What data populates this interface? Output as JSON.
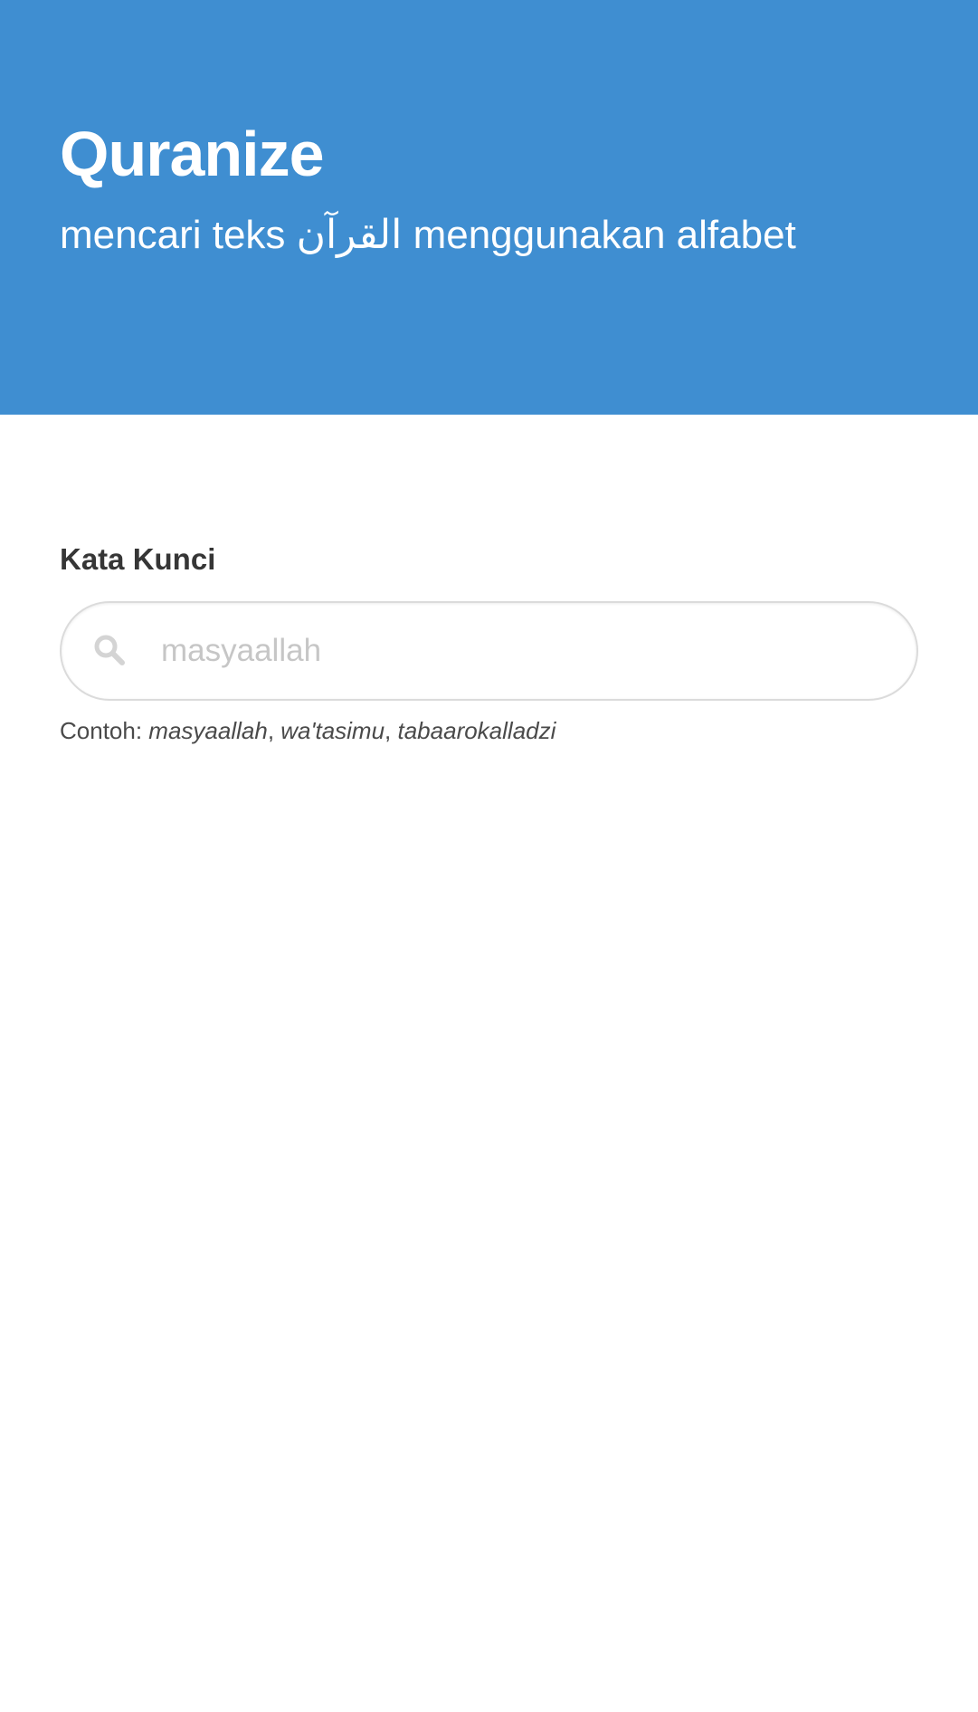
{
  "header": {
    "title": "Quranize",
    "subtitle": "mencari teks القرآن menggunakan alfabet"
  },
  "search": {
    "label": "Kata Kunci",
    "placeholder": "masyaallah",
    "value": "",
    "icon": "search-icon",
    "help_prefix": "Contoh: ",
    "examples": [
      "masyaallah",
      "wa'tasimu",
      "tabaarokalladzi"
    ],
    "separator": ", "
  },
  "colors": {
    "accent": "#3f8ed1",
    "label_text": "#363636",
    "placeholder": "#c6c6c6",
    "border": "#dbdbdb"
  }
}
